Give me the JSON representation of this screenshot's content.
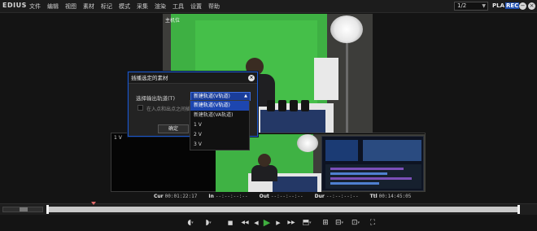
{
  "app": {
    "logo": "EDIUS"
  },
  "menu": [
    "文件",
    "编辑",
    "视图",
    "素材",
    "标记",
    "模式",
    "采集",
    "渲染",
    "工具",
    "设置",
    "帮助"
  ],
  "toolbar": {
    "page_select": "1/2",
    "pla_label": "PLA",
    "rec_label": "REC",
    "minimize_glyph": "−",
    "close_glyph": "×"
  },
  "player": {
    "label": "主机位"
  },
  "recorder": {
    "label": "1 V"
  },
  "timecodes": [
    {
      "label": "Cur",
      "value": "00:01:22:17"
    },
    {
      "label": "In",
      "value": "--:--:--:--"
    },
    {
      "label": "Out",
      "value": "--:--:--:--"
    },
    {
      "label": "Dur",
      "value": "--:--:--:--"
    },
    {
      "label": "Ttl",
      "value": "00:14:45:05"
    }
  ],
  "dialog": {
    "title": "插播选定的素材",
    "close_glyph": "×",
    "track_label": "选择输出轨道(T)",
    "track_selected": "新建轨道(V轨道)",
    "checkbox_label": "在入点和出点之间插入",
    "checkbox_checked": false,
    "ok_label": "确定",
    "options": [
      "新建轨道(V轨道)",
      "新建轨道(VA轨道)",
      "1 V",
      "2 V",
      "3 V"
    ]
  },
  "transport": {
    "buttons": [
      {
        "name": "mark-in-button",
        "glyph": "◖"
      },
      {
        "name": "mark-out-button",
        "glyph": "◗"
      },
      {
        "name": "stop-button",
        "glyph": "■"
      },
      {
        "name": "rewind-button",
        "glyph": "◀◀"
      },
      {
        "name": "step-back-button",
        "glyph": "◀"
      },
      {
        "name": "play-button",
        "glyph": "▶"
      },
      {
        "name": "step-forward-button",
        "glyph": "▶"
      },
      {
        "name": "fast-forward-button",
        "glyph": "▶▶"
      },
      {
        "name": "loop-button",
        "glyph": "⬒"
      },
      {
        "name": "insert-button",
        "glyph": "⊞"
      },
      {
        "name": "overwrite-button",
        "glyph": "⊟"
      },
      {
        "name": "clip-marker-button",
        "glyph": "⊡"
      },
      {
        "name": "fullscreen-button",
        "glyph": "⛶"
      }
    ]
  },
  "colors": {
    "accent": "#1e57c8",
    "play": "#3fae3f",
    "rec_badge": "#1f4fb0"
  }
}
